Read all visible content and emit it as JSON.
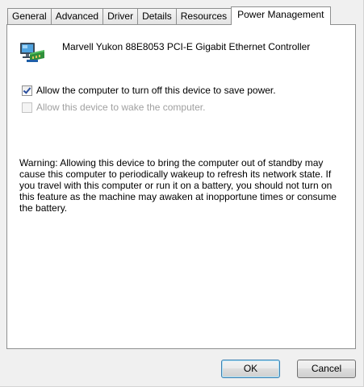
{
  "tabs": [
    {
      "label": "General"
    },
    {
      "label": "Advanced"
    },
    {
      "label": "Driver"
    },
    {
      "label": "Details"
    },
    {
      "label": "Resources"
    },
    {
      "label": "Power Management",
      "active": true
    }
  ],
  "device": {
    "icon": "network-adapter-icon",
    "name": "Marvell Yukon 88E8053 PCI-E Gigabit Ethernet Controller"
  },
  "options": {
    "allow_turn_off": {
      "label": "Allow the computer to turn off this device to save power.",
      "checked": true,
      "enabled": true
    },
    "allow_wake": {
      "label": "Allow this device to wake the computer.",
      "checked": false,
      "enabled": false
    }
  },
  "warning": "Warning: Allowing this device to bring the computer out of standby may cause this computer to periodically wakeup to refresh its network state. If you travel with this computer or run it on a battery, you should not turn on this feature as the machine may awaken at inopportune times or consume the battery.",
  "buttons": {
    "ok": "OK",
    "cancel": "Cancel"
  }
}
